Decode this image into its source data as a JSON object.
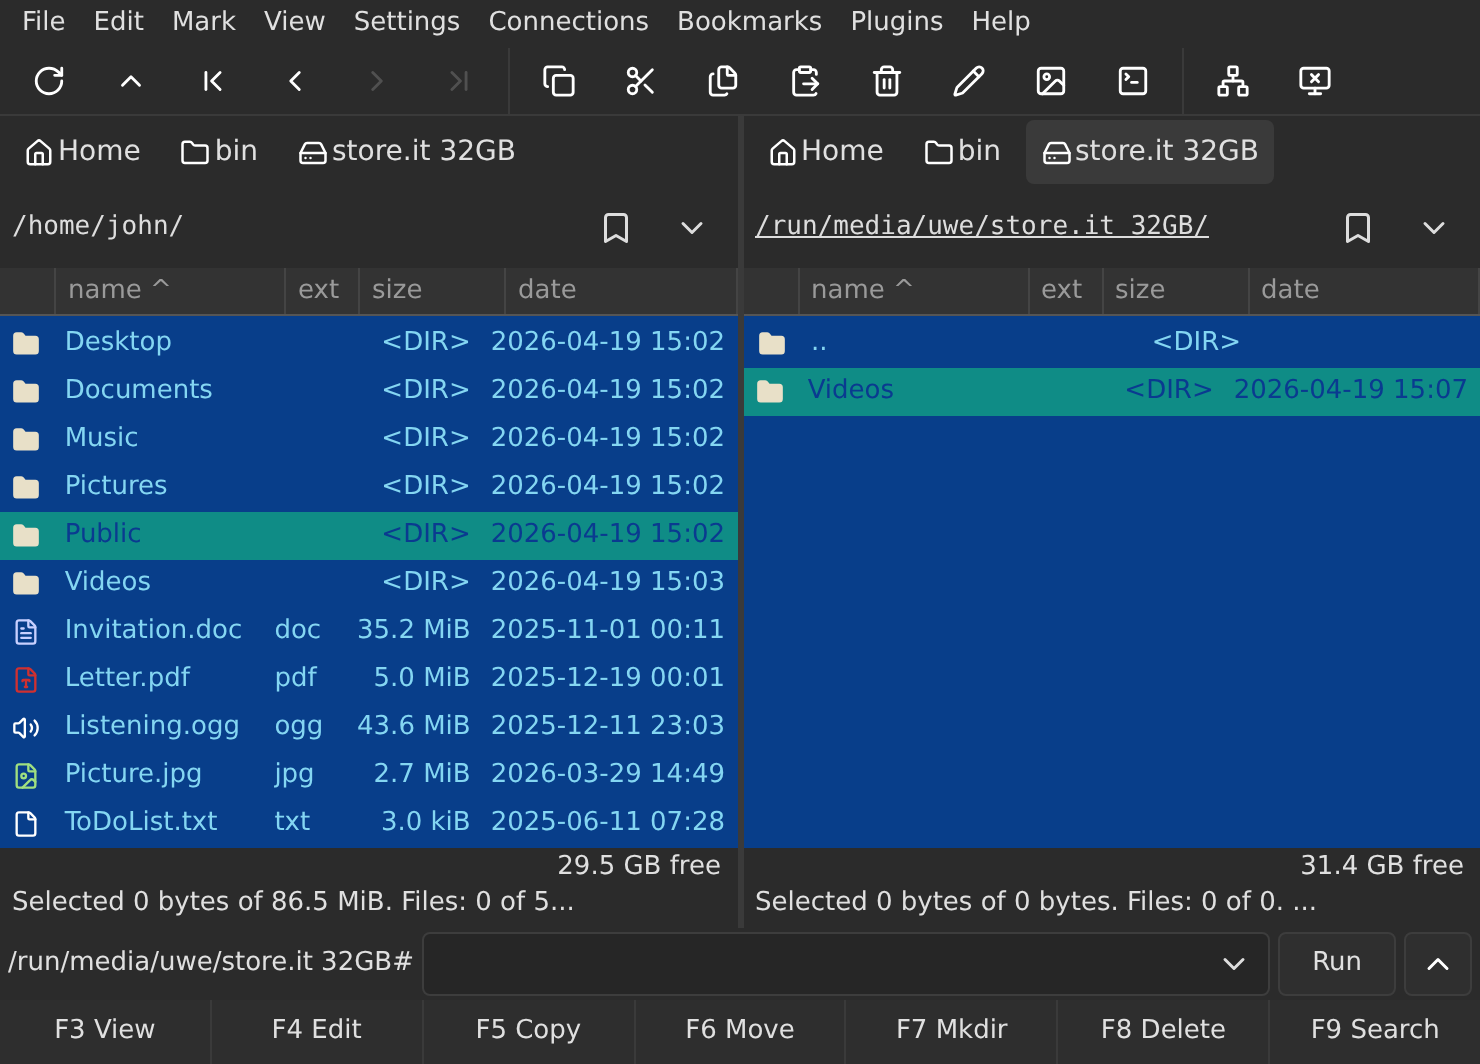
{
  "menu": [
    "File",
    "Edit",
    "Mark",
    "View",
    "Settings",
    "Connections",
    "Bookmarks",
    "Plugins",
    "Help"
  ],
  "toolbar": [
    [
      {
        "disabled": false
      },
      {
        "disabled": false
      },
      {
        "disabled": false
      },
      {
        "disabled": false
      },
      {
        "disabled": true
      },
      {
        "disabled": true
      }
    ],
    [
      {
        "disabled": false
      },
      {
        "disabled": false
      },
      {
        "disabled": false
      },
      {
        "disabled": false
      },
      {
        "disabled": false
      },
      {
        "disabled": false
      },
      {
        "disabled": false
      },
      {
        "disabled": false
      }
    ],
    [
      {
        "disabled": false
      },
      {
        "disabled": false
      }
    ]
  ],
  "panels": [
    {
      "active": false,
      "tabs": [
        {
          "kind": "home",
          "label": "Home",
          "selected": false
        },
        {
          "kind": "folder",
          "label": "bin",
          "selected": false
        },
        {
          "kind": "drive",
          "label": "store.it 32GB",
          "selected": false
        }
      ],
      "path": "/home/john/",
      "columns": [
        "name ^",
        "ext",
        "size",
        "date"
      ],
      "rows": [
        {
          "kind": "folder",
          "name": "Desktop",
          "ext": "",
          "size": "<DIR>",
          "date": "2026-04-19 15:02",
          "selected": false
        },
        {
          "kind": "folder",
          "name": "Documents",
          "ext": "",
          "size": "<DIR>",
          "date": "2026-04-19 15:02",
          "selected": false
        },
        {
          "kind": "folder",
          "name": "Music",
          "ext": "",
          "size": "<DIR>",
          "date": "2026-04-19 15:02",
          "selected": false
        },
        {
          "kind": "folder",
          "name": "Pictures",
          "ext": "",
          "size": "<DIR>",
          "date": "2026-04-19 15:02",
          "selected": false
        },
        {
          "kind": "folder",
          "name": "Public",
          "ext": "",
          "size": "<DIR>",
          "date": "2026-04-19 15:02",
          "selected": true
        },
        {
          "kind": "folder",
          "name": "Videos",
          "ext": "",
          "size": "<DIR>",
          "date": "2026-04-19 15:03",
          "selected": false
        },
        {
          "kind": "doc",
          "name": "Invitation.doc",
          "ext": "doc",
          "size": "35.2 MiB",
          "date": "2025-11-01 00:11",
          "selected": false
        },
        {
          "kind": "pdf",
          "name": "Letter.pdf",
          "ext": "pdf",
          "size": "5.0 MiB",
          "date": "2025-12-19 00:01",
          "selected": false
        },
        {
          "kind": "audio",
          "name": "Listening.ogg",
          "ext": "ogg",
          "size": "43.6 MiB",
          "date": "2025-12-11 23:03",
          "selected": false
        },
        {
          "kind": "image",
          "name": "Picture.jpg",
          "ext": "jpg",
          "size": "2.7 MiB",
          "date": "2026-03-29 14:49",
          "selected": false
        },
        {
          "kind": "text",
          "name": "ToDoList.txt",
          "ext": "txt",
          "size": "3.0 kiB",
          "date": "2025-06-11 07:28",
          "selected": false
        }
      ],
      "free": "29.5 GB free",
      "status": "Selected 0 bytes of 86.5 MiB. Files: 0 of 5..."
    },
    {
      "active": true,
      "tabs": [
        {
          "kind": "home",
          "label": "Home",
          "selected": false
        },
        {
          "kind": "folder",
          "label": "bin",
          "selected": false
        },
        {
          "kind": "drive",
          "label": "store.it 32GB",
          "selected": true
        }
      ],
      "path": "/run/media/uwe/store.it 32GB/",
      "columns": [
        "name ^",
        "ext",
        "size",
        "date"
      ],
      "rows": [
        {
          "kind": "folder",
          "name": "..",
          "ext": "",
          "size": "<DIR>",
          "date": "",
          "selected": false
        },
        {
          "kind": "folder",
          "name": "Videos",
          "ext": "",
          "size": "<DIR>",
          "date": "2026-04-19 15:07",
          "selected": true
        }
      ],
      "free": "31.4 GB free",
      "status": "Selected 0 bytes of 0 bytes. Files: 0 of 0. ..."
    }
  ],
  "command": {
    "prompt": "/run/media/uwe/store.it 32GB#",
    "run": "Run"
  },
  "function_keys": [
    "F3 View",
    "F4 Edit",
    "F5 Copy",
    "F6 Move",
    "F7 Mkdir",
    "F8 Delete",
    "F9 Search"
  ]
}
